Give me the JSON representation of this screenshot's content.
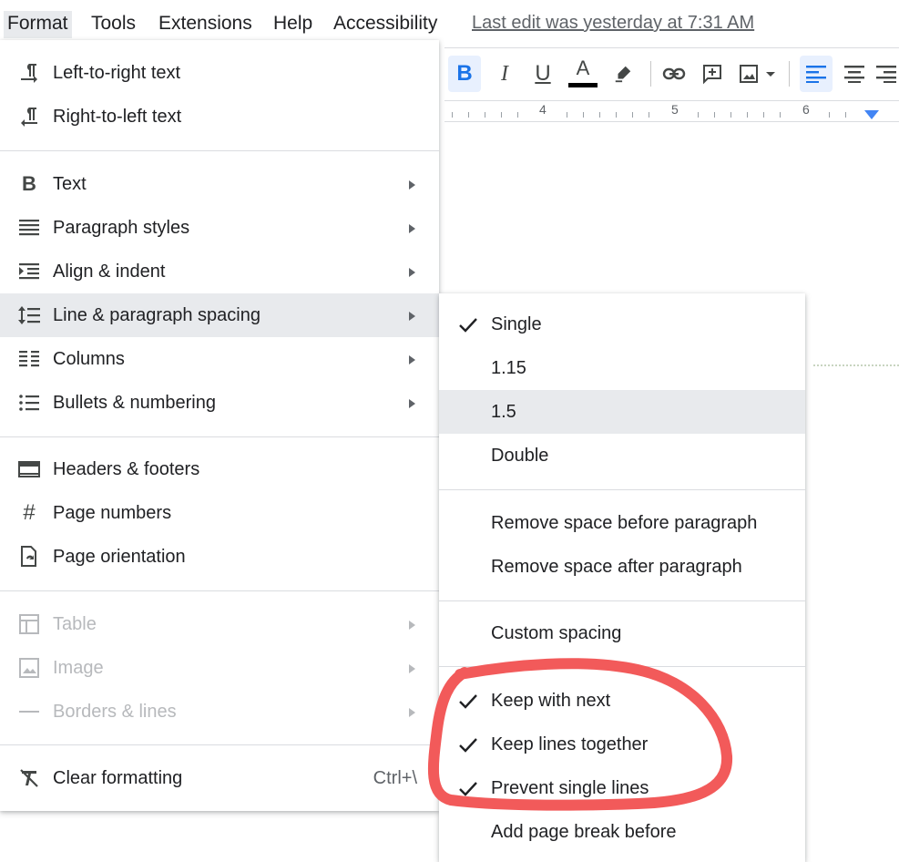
{
  "menubar": {
    "items": [
      {
        "label": "Format"
      },
      {
        "label": "Tools"
      },
      {
        "label": "Extensions"
      },
      {
        "label": "Help"
      },
      {
        "label": "Accessibility"
      }
    ],
    "last_edit": "Last edit was yesterday at 7:31 AM"
  },
  "toolbar": {
    "bold": "B",
    "italic": "I",
    "underline": "U",
    "text_color": "A",
    "text_color_value": "#000000"
  },
  "ruler": {
    "marks": [
      "4",
      "5",
      "6"
    ]
  },
  "format_menu": {
    "items": [
      {
        "label": "Left-to-right text",
        "icon": "ltr-text-icon"
      },
      {
        "label": "Right-to-left text",
        "icon": "rtl-text-icon"
      },
      {
        "label": "Text",
        "icon": "bold-b-icon",
        "submenu": true
      },
      {
        "label": "Paragraph styles",
        "icon": "paragraph-styles-icon",
        "submenu": true
      },
      {
        "label": "Align & indent",
        "icon": "indent-icon",
        "submenu": true
      },
      {
        "label": "Line & paragraph spacing",
        "icon": "line-spacing-icon",
        "submenu": true,
        "highlighted": true
      },
      {
        "label": "Columns",
        "icon": "columns-icon",
        "submenu": true
      },
      {
        "label": "Bullets & numbering",
        "icon": "bulleted-list-icon",
        "submenu": true
      },
      {
        "label": "Headers & footers",
        "icon": "header-footer-icon"
      },
      {
        "label": "Page numbers",
        "icon": "hash-icon"
      },
      {
        "label": "Page orientation",
        "icon": "page-orientation-icon"
      },
      {
        "label": "Table",
        "icon": "table-icon",
        "submenu": true,
        "disabled": true
      },
      {
        "label": "Image",
        "icon": "image-icon",
        "submenu": true,
        "disabled": true
      },
      {
        "label": "Borders & lines",
        "icon": "borders-icon",
        "submenu": true,
        "disabled": true
      },
      {
        "label": "Clear formatting",
        "icon": "clear-formatting-icon",
        "shortcut": "Ctrl+\\"
      }
    ]
  },
  "spacing_menu": {
    "items": [
      {
        "label": "Single",
        "checked": true
      },
      {
        "label": "1.15",
        "checked": false
      },
      {
        "label": "1.5",
        "checked": false,
        "highlighted": true
      },
      {
        "label": "Double",
        "checked": false
      },
      {
        "label": "Remove space before paragraph",
        "checked": false
      },
      {
        "label": "Remove space after paragraph",
        "checked": false
      },
      {
        "label": "Custom spacing",
        "checked": false
      },
      {
        "label": "Keep with next",
        "checked": true
      },
      {
        "label": "Keep lines together",
        "checked": true
      },
      {
        "label": "Prevent single lines",
        "checked": true
      },
      {
        "label": "Add page break before",
        "checked": false
      }
    ]
  },
  "colors": {
    "accent": "#1a73e8",
    "annotation": "#f25a5a",
    "highlight": "#e8eaed"
  }
}
